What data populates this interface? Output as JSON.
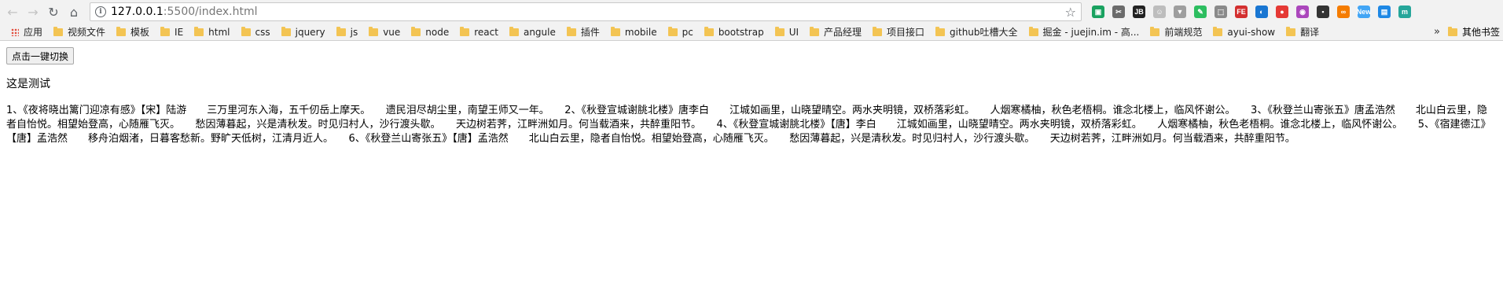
{
  "browser": {
    "url_host": "127.0.0.1",
    "url_rest": ":5500/index.html",
    "extensions": [
      {
        "name": "ext-1",
        "color": "#1aa260",
        "glyph": "▣"
      },
      {
        "name": "ext-2",
        "color": "#6b6b6b",
        "glyph": "✂"
      },
      {
        "name": "ext-3",
        "color": "#222222",
        "glyph": "JB"
      },
      {
        "name": "ext-4",
        "color": "#bdbdbd",
        "glyph": "☺"
      },
      {
        "name": "ext-5",
        "color": "#9e9e9e",
        "glyph": "▼"
      },
      {
        "name": "ext-6",
        "color": "#2dbe60",
        "glyph": "✎"
      },
      {
        "name": "ext-7",
        "color": "#8a8a8a",
        "glyph": "⬚"
      },
      {
        "name": "ext-8",
        "color": "#d32f2f",
        "glyph": "FE"
      },
      {
        "name": "ext-9",
        "color": "#1976d2",
        "glyph": "◐"
      },
      {
        "name": "ext-10",
        "color": "#e53935",
        "glyph": "●"
      },
      {
        "name": "ext-11",
        "color": "#ab47bc",
        "glyph": "◉"
      },
      {
        "name": "ext-12",
        "color": "#333333",
        "glyph": "▪"
      },
      {
        "name": "ext-13",
        "color": "#f57c00",
        "glyph": "∞"
      },
      {
        "name": "ext-14",
        "color": "#42a5f5",
        "glyph": "New"
      },
      {
        "name": "ext-15",
        "color": "#1e88e5",
        "glyph": "▤"
      },
      {
        "name": "ext-16",
        "color": "#26a69a",
        "glyph": "m"
      }
    ]
  },
  "bookmarks": {
    "apps": "应用",
    "items": [
      "视频文件",
      "模板",
      "IE",
      "html",
      "css",
      "jquery",
      "js",
      "vue",
      "node",
      "react",
      "angule",
      "插件",
      "mobile",
      "pc",
      "bootstrap",
      "UI",
      "产品经理",
      "项目接口",
      "github吐槽大全",
      "掘金 - juejin.im - 高...",
      "前端规范",
      "ayui-show",
      "翻译"
    ],
    "overflow": "»",
    "other": "其他书签"
  },
  "page": {
    "button_label": "点击一键切换",
    "test_text": "这是测试",
    "poem_text": "1、《夜将晓出篱门迎凉有感》【宋】陆游　　三万里河东入海，五千仞岳上摩天。　　遗民泪尽胡尘里，南望王师又一年。　　2、《秋登宣城谢朓北楼》唐李白　　江城如画里，山晓望晴空。两水夹明镜，双桥落彩虹。　　人烟寒橘柚，秋色老梧桐。谁念北楼上，临风怀谢公。　　3、《秋登兰山寄张五》唐孟浩然　　北山白云里，隐者自怡悦。相望始登高，心随雁飞灭。　　愁因薄暮起，兴是清秋发。时见归村人，沙行渡头歇。　　天边树若荠，江畔洲如月。何当载酒来，共醉重阳节。　　4、《秋登宣城谢朓北楼》【唐】李白　　江城如画里，山晓望晴空。两水夹明镜，双桥落彩虹。　　人烟寒橘柚，秋色老梧桐。谁念北楼上，临风怀谢公。　　5、《宿建德江》【唐】孟浩然　　移舟泊烟渚，日暮客愁新。野旷天低树，江清月近人。　　6、《秋登兰山寄张五》【唐】孟浩然　　北山白云里，隐者自怡悦。相望始登高，心随雁飞灭。　　愁因薄暮起，兴是清秋发。时见归村人，沙行渡头歇。　　天边树若荠，江畔洲如月。何当载酒来，共醉重阳节。"
  }
}
